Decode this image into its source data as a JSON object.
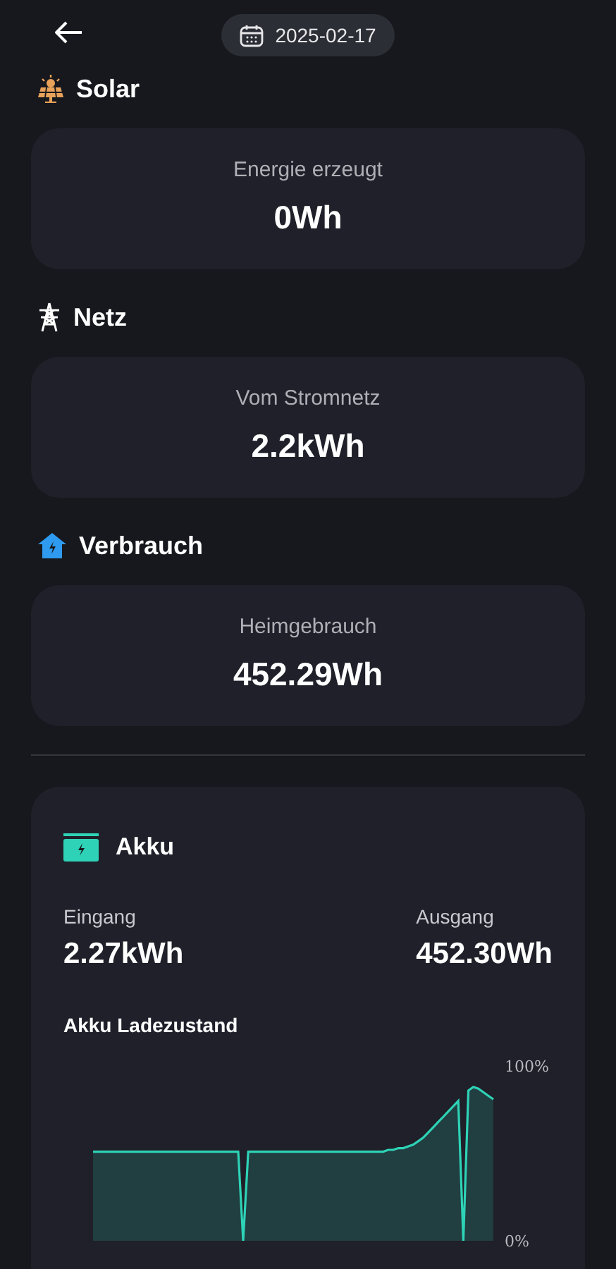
{
  "header": {
    "date": "2025-02-17"
  },
  "sections": [
    {
      "kind": "solar",
      "title": "Solar",
      "label": "Energie erzeugt",
      "value": "0Wh"
    },
    {
      "kind": "grid",
      "title": "Netz",
      "label": "Vom Stromnetz",
      "value": "2.2kWh"
    },
    {
      "kind": "home",
      "title": "Verbrauch",
      "label": "Heimgebrauch",
      "value": "452.29Wh"
    }
  ],
  "battery": {
    "title": "Akku",
    "stats": [
      {
        "label": "Eingang",
        "value": "2.27kWh"
      },
      {
        "label": "Ausgang",
        "value": "452.30Wh"
      }
    ],
    "chart_data": {
      "type": "area",
      "title": "Akku Ladezustand",
      "ylim": [
        0,
        100
      ],
      "yticks": [
        {
          "value": 100,
          "label": "100%"
        },
        {
          "value": 0,
          "label": "0%"
        }
      ],
      "series": [
        {
          "color": "#2ed3b7",
          "values": [
            51,
            51,
            51,
            51,
            51,
            51,
            51,
            51,
            51,
            51,
            51,
            51,
            51,
            51,
            51,
            51,
            51,
            51,
            51,
            51,
            51,
            51,
            51,
            51,
            51,
            51,
            51,
            51,
            51,
            51,
            0,
            51,
            51,
            51,
            51,
            51,
            51,
            51,
            51,
            51,
            51,
            51,
            51,
            51,
            51,
            51,
            51,
            51,
            51,
            51,
            51,
            51,
            51,
            51,
            51,
            51,
            51,
            51,
            51,
            52,
            52,
            53,
            53,
            54,
            55,
            57,
            59,
            62,
            65,
            68,
            71,
            74,
            77,
            80,
            0,
            86,
            88,
            87,
            85,
            83,
            81
          ]
        }
      ]
    }
  }
}
